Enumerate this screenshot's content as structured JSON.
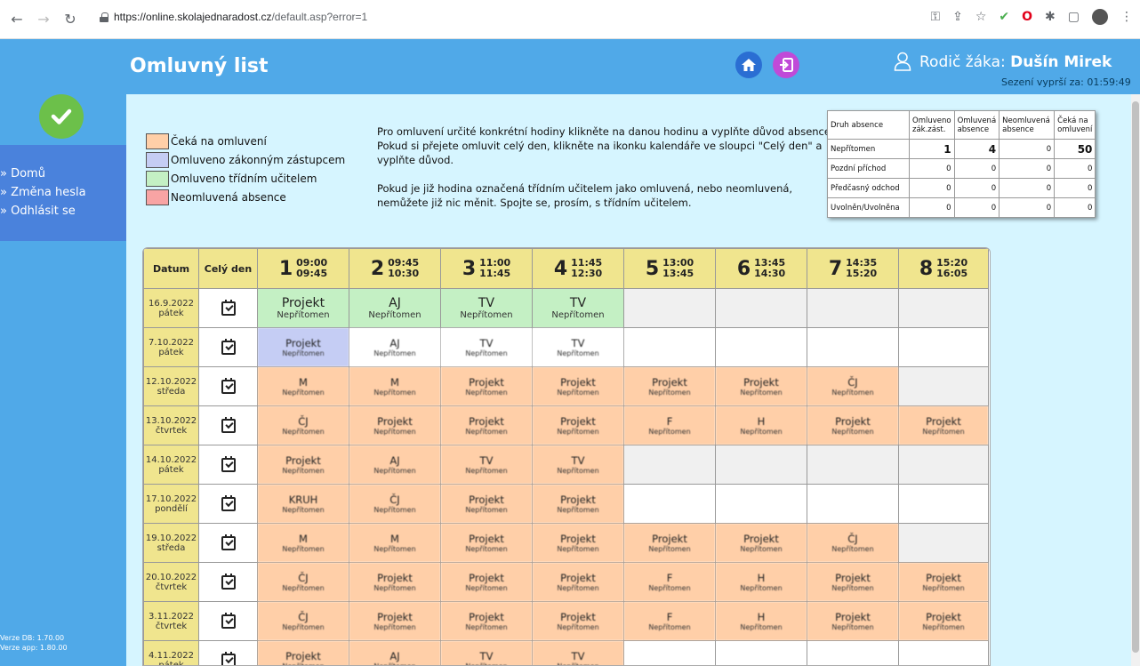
{
  "browser": {
    "url_host": "https://online.skolajednaradost.cz",
    "url_path": "/default.asp?error=1"
  },
  "header": {
    "title": "Omluvný list",
    "parent_label": "Rodič žáka:",
    "parent_name": "Dušín Mirek",
    "session_label": "Sezení vyprší za:",
    "session_time": "01:59:49"
  },
  "sidebar": {
    "items": [
      {
        "label": "» Domů"
      },
      {
        "label": "» Změna hesla"
      },
      {
        "label": "» Odhlásit se"
      }
    ],
    "version_db": "Verze DB: 1.70.00",
    "version_app": "Verze app: 1.80.00"
  },
  "legend": [
    {
      "label": "Čeká na omluvení",
      "color": "#ffcfa8"
    },
    {
      "label": "Omluveno zákonným zástupcem",
      "color": "#c5cdf4"
    },
    {
      "label": "Omluveno třídním učitelem",
      "color": "#c4f0c4"
    },
    {
      "label": "Neomluvená absence",
      "color": "#f8a4a4"
    }
  ],
  "info": {
    "p1": "Pro omluvení určité konkrétní hodiny klikněte na danou hodinu a vyplňte důvod absence. Pokud si přejete omluvit celý den, klikněte na ikonku kalendáře ve sloupci \"Celý den\" a vyplňte důvod.",
    "p2": "Pokud je již hodina označená třídním učitelem jako omluvená, nebo neomluvená, nemůžete již nic měnit. Spojte se, prosím, s třídním učitelem."
  },
  "summary": {
    "headers": [
      "Druh absence",
      "Omluveno zák.zást.",
      "Omluvená absence",
      "Neomluvená absence",
      "Čeká na omluvení"
    ],
    "rows": [
      {
        "label": "Nepřítomen",
        "values": [
          "1",
          "4",
          "0",
          "50"
        ]
      },
      {
        "label": "Pozdní příchod",
        "values": [
          "0",
          "0",
          "0",
          "0"
        ]
      },
      {
        "label": "Předčasný odchod",
        "values": [
          "0",
          "0",
          "0",
          "0"
        ]
      },
      {
        "label": "Uvolněn/Uvolněna",
        "values": [
          "0",
          "0",
          "0",
          "0"
        ]
      }
    ]
  },
  "grid": {
    "col_date": "Datum",
    "col_fullday": "Celý den",
    "periods": [
      {
        "num": "1",
        "from": "09:00",
        "to": "09:45"
      },
      {
        "num": "2",
        "from": "09:45",
        "to": "10:30"
      },
      {
        "num": "3",
        "from": "11:00",
        "to": "11:45"
      },
      {
        "num": "4",
        "from": "11:45",
        "to": "12:30"
      },
      {
        "num": "5",
        "from": "13:00",
        "to": "13:45"
      },
      {
        "num": "6",
        "from": "13:45",
        "to": "14:30"
      },
      {
        "num": "7",
        "from": "14:35",
        "to": "15:20"
      },
      {
        "num": "8",
        "from": "15:20",
        "to": "16:05"
      }
    ],
    "rows": [
      {
        "date": "16.9.2022",
        "day": "pátek",
        "cells": [
          {
            "subj": "Projekt",
            "stat": "Nepřítomen",
            "state": "green"
          },
          {
            "subj": "AJ",
            "stat": "Nepřítomen",
            "state": "green"
          },
          {
            "subj": "TV",
            "stat": "Nepřítomen",
            "state": "green"
          },
          {
            "subj": "TV",
            "stat": "Nepřítomen",
            "state": "green"
          },
          {
            "subj": "",
            "stat": "",
            "state": "empty"
          },
          {
            "subj": "",
            "stat": "",
            "state": "empty"
          },
          {
            "subj": "",
            "stat": "",
            "state": "empty"
          },
          {
            "subj": "",
            "stat": "",
            "state": "empty"
          }
        ]
      },
      {
        "date": "7.10.2022",
        "day": "pátek",
        "cells": [
          {
            "subj": "Projekt",
            "stat": "Nepřítomen",
            "state": "blue"
          },
          {
            "subj": "AJ",
            "stat": "Nepřítomen",
            "state": "white"
          },
          {
            "subj": "TV",
            "stat": "Nepřítomen",
            "state": "white"
          },
          {
            "subj": "TV",
            "stat": "Nepřítomen",
            "state": "white"
          },
          {
            "subj": "",
            "stat": "",
            "state": "white"
          },
          {
            "subj": "",
            "stat": "",
            "state": "white"
          },
          {
            "subj": "",
            "stat": "",
            "state": "white"
          },
          {
            "subj": "",
            "stat": "",
            "state": "white"
          }
        ]
      },
      {
        "date": "12.10.2022",
        "day": "středa",
        "cells": [
          {
            "subj": "M",
            "stat": "Nepřítomen",
            "state": "orange"
          },
          {
            "subj": "M",
            "stat": "Nepřítomen",
            "state": "orange"
          },
          {
            "subj": "Projekt",
            "stat": "Nepřítomen",
            "state": "orange"
          },
          {
            "subj": "Projekt",
            "stat": "Nepřítomen",
            "state": "orange"
          },
          {
            "subj": "Projekt",
            "stat": "Nepřítomen",
            "state": "orange"
          },
          {
            "subj": "Projekt",
            "stat": "Nepřítomen",
            "state": "orange"
          },
          {
            "subj": "ČJ",
            "stat": "Nepřítomen",
            "state": "orange"
          },
          {
            "subj": "",
            "stat": "",
            "state": "empty"
          }
        ]
      },
      {
        "date": "13.10.2022",
        "day": "čtvrtek",
        "cells": [
          {
            "subj": "ČJ",
            "stat": "Nepřítomen",
            "state": "orange"
          },
          {
            "subj": "Projekt",
            "stat": "Nepřítomen",
            "state": "orange"
          },
          {
            "subj": "Projekt",
            "stat": "Nepřítomen",
            "state": "orange"
          },
          {
            "subj": "Projekt",
            "stat": "Nepřítomen",
            "state": "orange"
          },
          {
            "subj": "F",
            "stat": "Nepřítomen",
            "state": "orange"
          },
          {
            "subj": "H",
            "stat": "Nepřítomen",
            "state": "orange"
          },
          {
            "subj": "Projekt",
            "stat": "Nepřítomen",
            "state": "orange"
          },
          {
            "subj": "Projekt",
            "stat": "Nepřítomen",
            "state": "orange"
          }
        ]
      },
      {
        "date": "14.10.2022",
        "day": "pátek",
        "cells": [
          {
            "subj": "Projekt",
            "stat": "Nepřítomen",
            "state": "orange"
          },
          {
            "subj": "AJ",
            "stat": "Nepřítomen",
            "state": "orange"
          },
          {
            "subj": "TV",
            "stat": "Nepřítomen",
            "state": "orange"
          },
          {
            "subj": "TV",
            "stat": "Nepřítomen",
            "state": "orange"
          },
          {
            "subj": "",
            "stat": "",
            "state": "empty"
          },
          {
            "subj": "",
            "stat": "",
            "state": "empty"
          },
          {
            "subj": "",
            "stat": "",
            "state": "empty"
          },
          {
            "subj": "",
            "stat": "",
            "state": "empty"
          }
        ]
      },
      {
        "date": "17.10.2022",
        "day": "pondělí",
        "cells": [
          {
            "subj": "KRUH",
            "stat": "Nepřítomen",
            "state": "orange"
          },
          {
            "subj": "ČJ",
            "stat": "Nepřítomen",
            "state": "orange"
          },
          {
            "subj": "Projekt",
            "stat": "Nepřítomen",
            "state": "orange"
          },
          {
            "subj": "Projekt",
            "stat": "Nepřítomen",
            "state": "orange"
          },
          {
            "subj": "",
            "stat": "",
            "state": "white"
          },
          {
            "subj": "",
            "stat": "",
            "state": "white"
          },
          {
            "subj": "",
            "stat": "",
            "state": "white"
          },
          {
            "subj": "",
            "stat": "",
            "state": "white"
          }
        ]
      },
      {
        "date": "19.10.2022",
        "day": "středa",
        "cells": [
          {
            "subj": "M",
            "stat": "Nepřítomen",
            "state": "orange"
          },
          {
            "subj": "M",
            "stat": "Nepřítomen",
            "state": "orange"
          },
          {
            "subj": "Projekt",
            "stat": "Nepřítomen",
            "state": "orange"
          },
          {
            "subj": "Projekt",
            "stat": "Nepřítomen",
            "state": "orange"
          },
          {
            "subj": "Projekt",
            "stat": "Nepřítomen",
            "state": "orange"
          },
          {
            "subj": "Projekt",
            "stat": "Nepřítomen",
            "state": "orange"
          },
          {
            "subj": "ČJ",
            "stat": "Nepřítomen",
            "state": "orange"
          },
          {
            "subj": "",
            "stat": "",
            "state": "empty"
          }
        ]
      },
      {
        "date": "20.10.2022",
        "day": "čtvrtek",
        "cells": [
          {
            "subj": "ČJ",
            "stat": "Nepřítomen",
            "state": "orange"
          },
          {
            "subj": "Projekt",
            "stat": "Nepřítomen",
            "state": "orange"
          },
          {
            "subj": "Projekt",
            "stat": "Nepřítomen",
            "state": "orange"
          },
          {
            "subj": "Projekt",
            "stat": "Nepřítomen",
            "state": "orange"
          },
          {
            "subj": "F",
            "stat": "Nepřítomen",
            "state": "orange"
          },
          {
            "subj": "H",
            "stat": "Nepřítomen",
            "state": "orange"
          },
          {
            "subj": "Projekt",
            "stat": "Nepřítomen",
            "state": "orange"
          },
          {
            "subj": "Projekt",
            "stat": "Nepřítomen",
            "state": "orange"
          }
        ]
      },
      {
        "date": "3.11.2022",
        "day": "čtvrtek",
        "cells": [
          {
            "subj": "ČJ",
            "stat": "Nepřítomen",
            "state": "orange"
          },
          {
            "subj": "Projekt",
            "stat": "Nepřítomen",
            "state": "orange"
          },
          {
            "subj": "Projekt",
            "stat": "Nepřítomen",
            "state": "orange"
          },
          {
            "subj": "Projekt",
            "stat": "Nepřítomen",
            "state": "orange"
          },
          {
            "subj": "F",
            "stat": "Nepřítomen",
            "state": "orange"
          },
          {
            "subj": "H",
            "stat": "Nepřítomen",
            "state": "orange"
          },
          {
            "subj": "Projekt",
            "stat": "Nepřítomen",
            "state": "orange"
          },
          {
            "subj": "Projekt",
            "stat": "Nepřítomen",
            "state": "orange"
          }
        ]
      },
      {
        "date": "4.11.2022",
        "day": "pátek",
        "cells": [
          {
            "subj": "Projekt",
            "stat": "Nepřítomen",
            "state": "orange"
          },
          {
            "subj": "AJ",
            "stat": "Nepřítomen",
            "state": "orange"
          },
          {
            "subj": "TV",
            "stat": "Nepřítomen",
            "state": "orange"
          },
          {
            "subj": "TV",
            "stat": "Nepřítomen",
            "state": "orange"
          },
          {
            "subj": "",
            "stat": "",
            "state": "white"
          },
          {
            "subj": "",
            "stat": "",
            "state": "white"
          },
          {
            "subj": "",
            "stat": "",
            "state": "white"
          },
          {
            "subj": "",
            "stat": "",
            "state": "white"
          }
        ]
      }
    ]
  }
}
